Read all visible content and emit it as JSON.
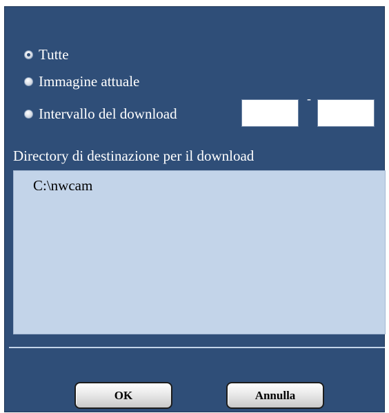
{
  "download_options": {
    "items": [
      {
        "label": "Tutte",
        "checked": true
      },
      {
        "label": "Immagine attuale",
        "checked": false
      },
      {
        "label": "Intervallo del download",
        "checked": false
      }
    ],
    "range": {
      "from_value": "",
      "to_value": "",
      "separator": "-"
    }
  },
  "destination": {
    "label": "Directory di destinazione per il download",
    "path": "C:\\nwcam"
  },
  "buttons": {
    "ok_label": "OK",
    "cancel_label": "Annulla"
  },
  "colors": {
    "dialog_background": "#2f4e78",
    "path_box_background": "#c3d4e9",
    "text": "#ffffff"
  }
}
